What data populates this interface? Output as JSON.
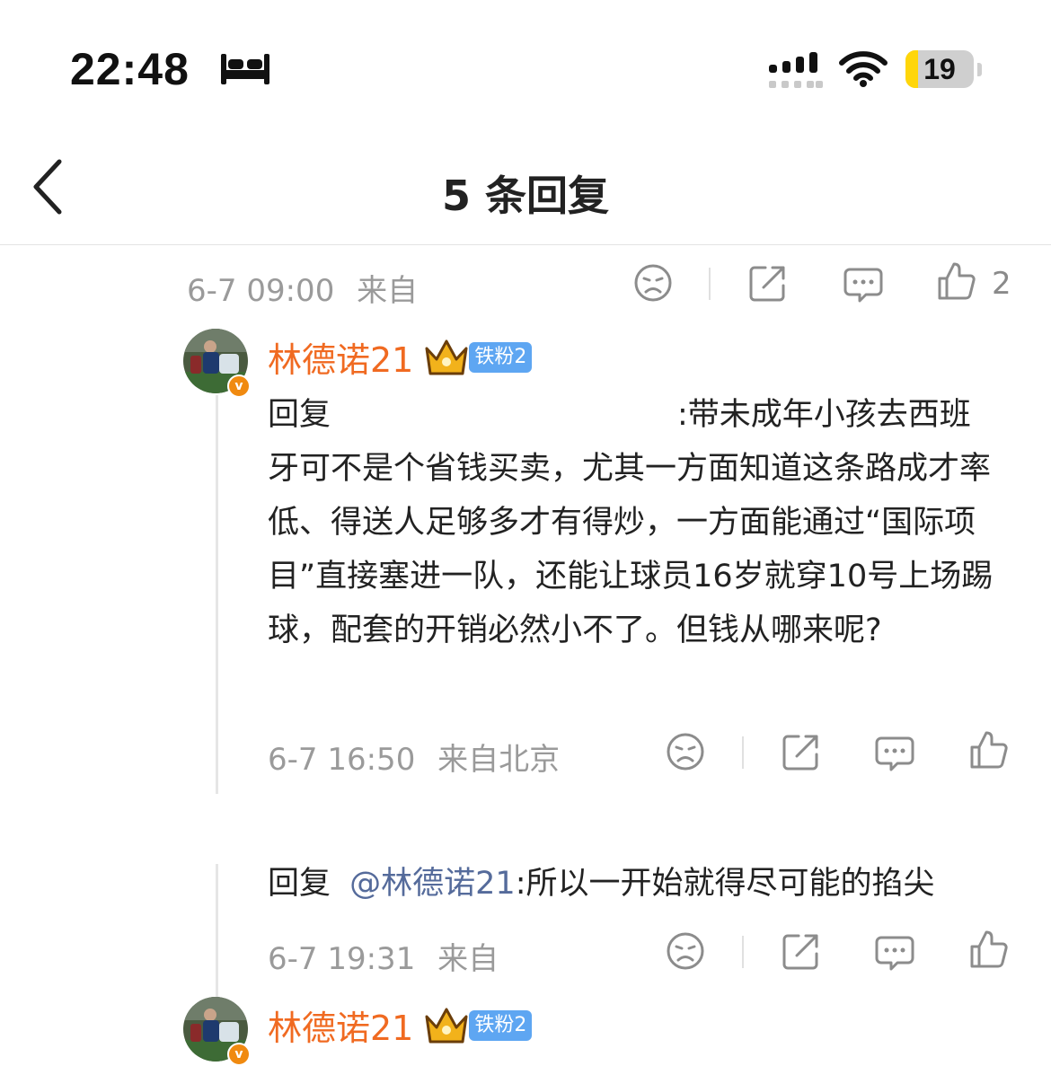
{
  "status_bar": {
    "time": "22:48",
    "battery": "19",
    "battery_level": 0.19,
    "bed_icon": "bed-icon",
    "signal_icon": "cellular-signal-icon",
    "wifi_icon": "wifi-icon"
  },
  "nav": {
    "title": "5 条回复",
    "back_icon": "back-chevron-icon"
  },
  "comment_top": {
    "date": "6-7 09:00",
    "source": "来自",
    "like_count": "2"
  },
  "reply1": {
    "username": "林德诺21",
    "fan_badge": "铁粉2",
    "verify": "v",
    "reply_prefix": "回复",
    "text_line1": ":带未成年小孩去西班",
    "text_rest": "牙可不是个省钱买卖，尤其一方面知道这条路成才率低、得送人足够多才有得炒，一方面能通过“国际项目”直接塞进一队，还能让球员16岁就穿10号上场踢球，配套的开销必然小不了。但钱从哪来呢?",
    "date": "6-7 16:50",
    "source": "来自北京"
  },
  "reply2": {
    "reply_prefix": "回复",
    "mention": "@林德诺21",
    "text": ":所以一开始就得尽可能的掐尖",
    "date": "6-7 19:31",
    "source": "来自"
  },
  "reply3": {
    "username": "林德诺21",
    "fan_badge": "铁粉2",
    "verify": "v"
  },
  "colors": {
    "username": "#f06a21",
    "mention": "#556b9b",
    "fan_badge": "#5ea6f2",
    "battery": "#ffd60a"
  }
}
